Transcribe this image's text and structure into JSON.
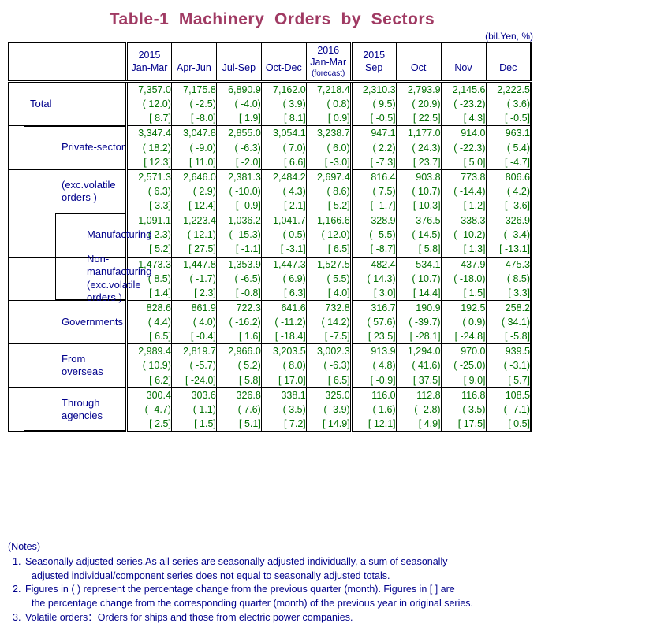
{
  "title": "Table-1  Machinery  Orders  by  Sectors",
  "unit": "(bil.Yen, %)",
  "colors": {
    "title": "#A03A63",
    "label": "#00008B",
    "value": "#007000"
  },
  "header": {
    "blank_label": "",
    "columns": [
      {
        "year": "2015",
        "period": "Jan-Mar",
        "note": ""
      },
      {
        "year": "",
        "period": "Apr-Jun",
        "note": ""
      },
      {
        "year": "",
        "period": "Jul-Sep",
        "note": ""
      },
      {
        "year": "",
        "period": "Oct-Dec",
        "note": ""
      },
      {
        "year": "2016",
        "period": "Jan-Mar",
        "note": "(forecast)"
      },
      {
        "year": "2015",
        "period": "Sep",
        "note": ""
      },
      {
        "year": "",
        "period": "Oct",
        "note": ""
      },
      {
        "year": "",
        "period": "Nov",
        "note": ""
      },
      {
        "year": "",
        "period": "Dec",
        "note": ""
      }
    ]
  },
  "rows": [
    {
      "label": "Total",
      "indent": 1,
      "cells": [
        {
          "value": "7,357.0",
          "qoq": "( 12.0)",
          "yoy": "[ 8.7]"
        },
        {
          "value": "7,175.8",
          "qoq": "( -2.5)",
          "yoy": "[ -8.0]"
        },
        {
          "value": "6,890.9",
          "qoq": "( -4.0)",
          "yoy": "[ 1.9]"
        },
        {
          "value": "7,162.0",
          "qoq": "( 3.9)",
          "yoy": "[ 8.1]"
        },
        {
          "value": "7,218.4",
          "qoq": "( 0.8)",
          "yoy": "[ 0.9]"
        },
        {
          "value": "2,310.3",
          "qoq": "( 9.5)",
          "yoy": "[ -0.5]"
        },
        {
          "value": "2,793.9",
          "qoq": "( 20.9)",
          "yoy": "[ 22.5]"
        },
        {
          "value": "2,145.6",
          "qoq": "( -23.2)",
          "yoy": "[ 4.3]"
        },
        {
          "value": "2,222.5",
          "qoq": "( 3.6)",
          "yoy": "[ -0.5]"
        }
      ]
    },
    {
      "label": "Private-sector",
      "indent": 2,
      "cells": [
        {
          "value": "3,347.4",
          "qoq": "( 18.2)",
          "yoy": "[ 12.3]"
        },
        {
          "value": "3,047.8",
          "qoq": "( -9.0)",
          "yoy": "[ 11.0]"
        },
        {
          "value": "2,855.0",
          "qoq": "( -6.3)",
          "yoy": "[ -2.0]"
        },
        {
          "value": "3,054.1",
          "qoq": "( 7.0)",
          "yoy": "[ 6.6]"
        },
        {
          "value": "3,238.7",
          "qoq": "( 6.0)",
          "yoy": "[ -3.0]"
        },
        {
          "value": "947.1",
          "qoq": "( 2.2)",
          "yoy": "[ -7.3]"
        },
        {
          "value": "1,177.0",
          "qoq": "( 24.3)",
          "yoy": "[ 23.7]"
        },
        {
          "value": "914.0",
          "qoq": "( -22.3)",
          "yoy": "[ 5.0]"
        },
        {
          "value": "963.1",
          "qoq": "( 5.4)",
          "yoy": "[ -4.7]"
        }
      ]
    },
    {
      "label": "(exc.volatile orders )",
      "indent": 2,
      "cells": [
        {
          "value": "2,571.3",
          "qoq": "( 6.3)",
          "yoy": "[ 3.3]"
        },
        {
          "value": "2,646.0",
          "qoq": "( 2.9)",
          "yoy": "[ 12.4]"
        },
        {
          "value": "2,381.3",
          "qoq": "( -10.0)",
          "yoy": "[ -0.9]"
        },
        {
          "value": "2,484.2",
          "qoq": "( 4.3)",
          "yoy": "[ 2.1]"
        },
        {
          "value": "2,697.4",
          "qoq": "( 8.6)",
          "yoy": "[ 5.2]"
        },
        {
          "value": "816.4",
          "qoq": "( 7.5)",
          "yoy": "[ -1.7]"
        },
        {
          "value": "903.8",
          "qoq": "( 10.7)",
          "yoy": "[ 10.3]"
        },
        {
          "value": "773.8",
          "qoq": "( -14.4)",
          "yoy": "[ 1.2]"
        },
        {
          "value": "806.6",
          "qoq": "( 4.2)",
          "yoy": "[ -3.6]"
        }
      ]
    },
    {
      "label": "Manufacturing",
      "indent": 3,
      "cells": [
        {
          "value": "1,091.1",
          "qoq": "( 2.3)",
          "yoy": "[ 5.2]"
        },
        {
          "value": "1,223.4",
          "qoq": "( 12.1)",
          "yoy": "[ 27.5]"
        },
        {
          "value": "1,036.2",
          "qoq": "( -15.3)",
          "yoy": "[ -1.1]"
        },
        {
          "value": "1,041.7",
          "qoq": "( 0.5)",
          "yoy": "[ -3.1]"
        },
        {
          "value": "1,166.6",
          "qoq": "( 12.0)",
          "yoy": "[ 6.5]"
        },
        {
          "value": "328.9",
          "qoq": "( -5.5)",
          "yoy": "[ -8.7]"
        },
        {
          "value": "376.5",
          "qoq": "( 14.5)",
          "yoy": "[ 5.8]"
        },
        {
          "value": "338.3",
          "qoq": "( -10.2)",
          "yoy": "[ 1.3]"
        },
        {
          "value": "326.9",
          "qoq": "( -3.4)",
          "yoy": "[ -13.1]"
        }
      ]
    },
    {
      "label": "Non-manufacturing\n(exc.volatile orders )",
      "indent": 3,
      "cells": [
        {
          "value": "1,473.3",
          "qoq": "( 8.5)",
          "yoy": "[ 1.4]"
        },
        {
          "value": "1,447.8",
          "qoq": "( -1.7)",
          "yoy": "[ 2.3]"
        },
        {
          "value": "1,353.9",
          "qoq": "( -6.5)",
          "yoy": "[ -0.8]"
        },
        {
          "value": "1,447.3",
          "qoq": "( 6.9)",
          "yoy": "[ 6.3]"
        },
        {
          "value": "1,527.5",
          "qoq": "( 5.5)",
          "yoy": "[ 4.0]"
        },
        {
          "value": "482.4",
          "qoq": "( 14.3)",
          "yoy": "[ 3.0]"
        },
        {
          "value": "534.1",
          "qoq": "( 10.7)",
          "yoy": "[ 14.4]"
        },
        {
          "value": "437.9",
          "qoq": "( -18.0)",
          "yoy": "[ 1.5]"
        },
        {
          "value": "475.3",
          "qoq": "( 8.5)",
          "yoy": "[ 3.3]"
        }
      ]
    },
    {
      "label": "Governments",
      "indent": 2,
      "cells": [
        {
          "value": "828.6",
          "qoq": "( 4.4)",
          "yoy": "[ 6.5]"
        },
        {
          "value": "861.9",
          "qoq": "( 4.0)",
          "yoy": "[ -0.4]"
        },
        {
          "value": "722.3",
          "qoq": "( -16.2)",
          "yoy": "[ 1.6]"
        },
        {
          "value": "641.6",
          "qoq": "( -11.2)",
          "yoy": "[ -18.4]"
        },
        {
          "value": "732.8",
          "qoq": "( 14.2)",
          "yoy": "[ -7.5]"
        },
        {
          "value": "316.7",
          "qoq": "( 57.6)",
          "yoy": "[ 23.5]"
        },
        {
          "value": "190.9",
          "qoq": "( -39.7)",
          "yoy": "[ -28.1]"
        },
        {
          "value": "192.5",
          "qoq": "( 0.9)",
          "yoy": "[ -24.8]"
        },
        {
          "value": "258.2",
          "qoq": "( 34.1)",
          "yoy": "[ -5.8]"
        }
      ]
    },
    {
      "label": "From overseas",
      "indent": 2,
      "cells": [
        {
          "value": "2,989.4",
          "qoq": "( 10.9)",
          "yoy": "[ 6.2]"
        },
        {
          "value": "2,819.7",
          "qoq": "( -5.7)",
          "yoy": "[ -24.0]"
        },
        {
          "value": "2,966.0",
          "qoq": "( 5.2)",
          "yoy": "[ 5.8]"
        },
        {
          "value": "3,203.5",
          "qoq": "( 8.0)",
          "yoy": "[ 17.0]"
        },
        {
          "value": "3,002.3",
          "qoq": "( -6.3)",
          "yoy": "[ 6.5]"
        },
        {
          "value": "913.9",
          "qoq": "( 4.8)",
          "yoy": "[ -0.9]"
        },
        {
          "value": "1,294.0",
          "qoq": "( 41.6)",
          "yoy": "[ 37.5]"
        },
        {
          "value": "970.0",
          "qoq": "( -25.0)",
          "yoy": "[ 9.0]"
        },
        {
          "value": "939.5",
          "qoq": "( -3.1)",
          "yoy": "[ 5.7]"
        }
      ]
    },
    {
      "label": "Through agencies",
      "indent": 2,
      "cells": [
        {
          "value": "300.4",
          "qoq": "( -4.7)",
          "yoy": "[ 2.5]"
        },
        {
          "value": "303.6",
          "qoq": "( 1.1)",
          "yoy": "[ 1.5]"
        },
        {
          "value": "326.8",
          "qoq": "( 7.6)",
          "yoy": "[ 5.1]"
        },
        {
          "value": "338.1",
          "qoq": "( 3.5)",
          "yoy": "[ 7.2]"
        },
        {
          "value": "325.0",
          "qoq": "( -3.9)",
          "yoy": "[ 14.9]"
        },
        {
          "value": "116.0",
          "qoq": "( 1.6)",
          "yoy": "[ 12.1]"
        },
        {
          "value": "112.8",
          "qoq": "( -2.8)",
          "yoy": "[ 4.9]"
        },
        {
          "value": "116.8",
          "qoq": "( 3.5)",
          "yoy": "[ 17.5]"
        },
        {
          "value": "108.5",
          "qoq": "( -7.1)",
          "yoy": "[ 0.5]"
        }
      ]
    }
  ],
  "notes": {
    "heading": "(Notes)",
    "items": [
      {
        "line1": "Seasonally adjusted series.As all series are seasonally adjusted individually, a sum of seasonally",
        "line2": "adjusted individual/component series does not equal to seasonally adjusted totals."
      },
      {
        "line1": "Figures in ( ) represent the percentage change from the previous quarter (month). Figures in [ ] are",
        "line2": "the percentage change from the corresponding quarter (month) of the previous year in original series."
      },
      {
        "line1": "Volatile orders：Orders for ships and those from electric power companies.",
        "line2": ""
      }
    ]
  }
}
